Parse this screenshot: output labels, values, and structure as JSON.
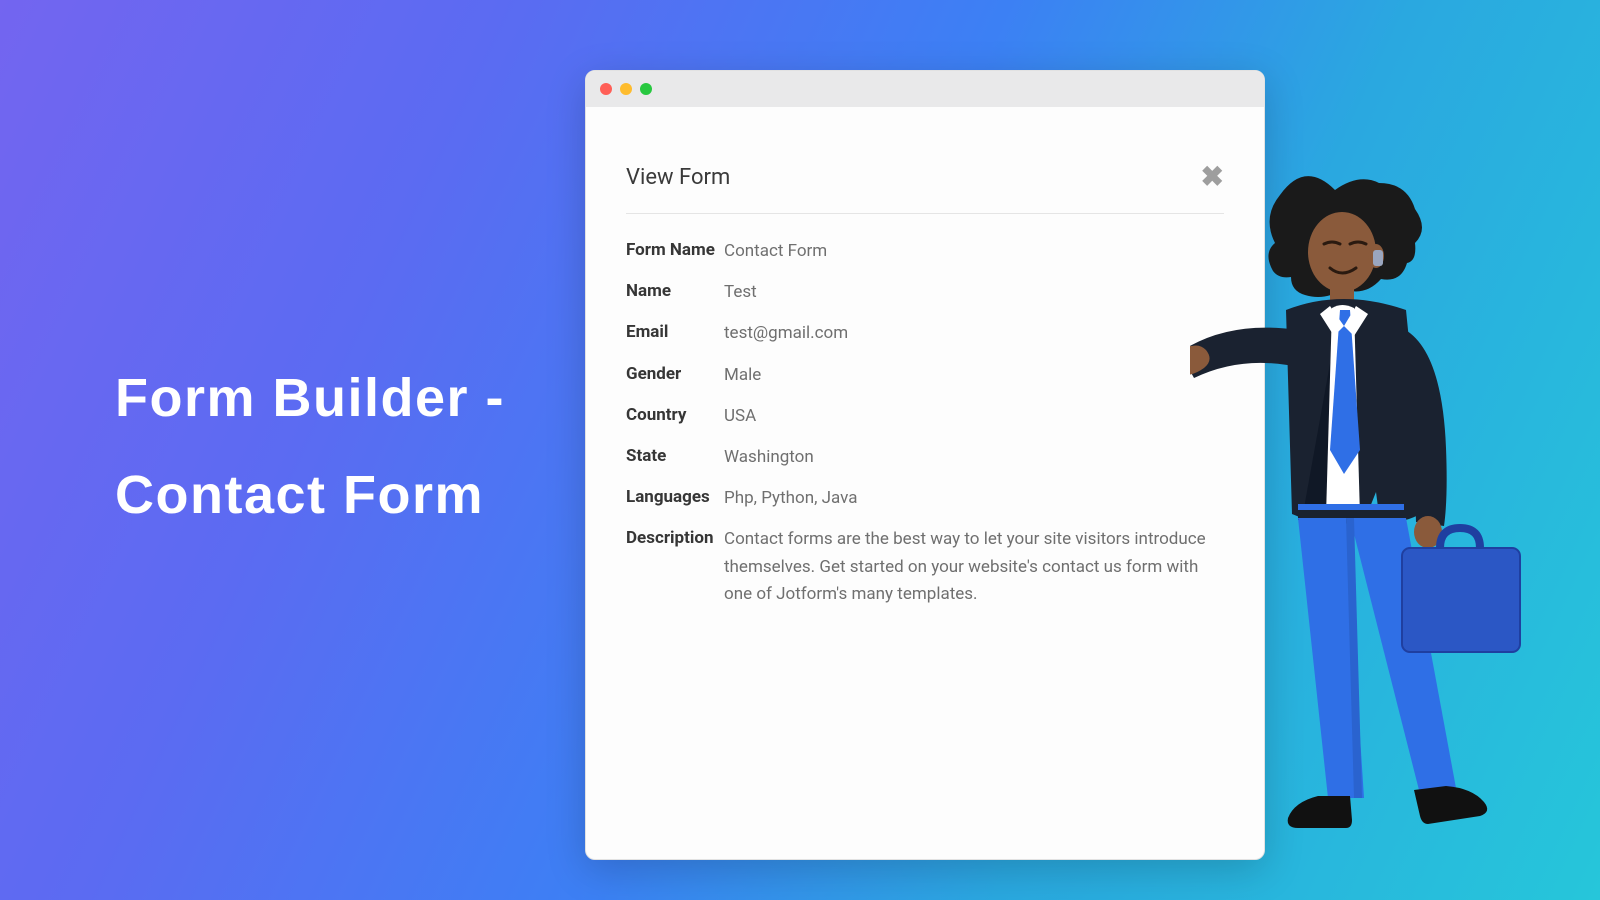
{
  "hero": {
    "line1": "Form Builder -",
    "line2": "Contact Form"
  },
  "modal": {
    "title": "View Form",
    "fields": [
      {
        "label": "Form Name",
        "value": "Contact Form"
      },
      {
        "label": "Name",
        "value": "Test"
      },
      {
        "label": "Email",
        "value": "test@gmail.com"
      },
      {
        "label": "Gender",
        "value": "Male"
      },
      {
        "label": "Country",
        "value": "USA"
      },
      {
        "label": "State",
        "value": "Washington"
      },
      {
        "label": "Languages",
        "value": "Php, Python, Java"
      },
      {
        "label": "Description",
        "value": "Contact forms are the best way to let your site visitors introduce themselves. Get started on your website's contact us form with one of Jotform's many templates."
      }
    ]
  },
  "colors": {
    "accent_blue": "#2f6fe6",
    "suit_dark": "#1a2230"
  }
}
